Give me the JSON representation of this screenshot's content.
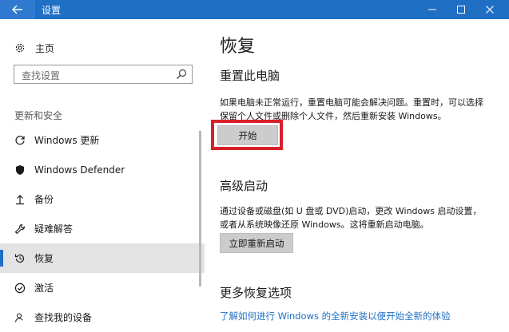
{
  "window": {
    "title": "设置",
    "colors": {
      "titlebar": "#1f6fc5",
      "accent": "#1f6fc5",
      "highlight": "#d8202a"
    }
  },
  "sidebar": {
    "home_label": "主页",
    "search_placeholder": "查找设置",
    "section_label": "更新和安全",
    "items": [
      {
        "label": "Windows 更新",
        "icon": "refresh-icon",
        "active": false
      },
      {
        "label": "Windows Defender",
        "icon": "shield-icon",
        "active": false
      },
      {
        "label": "备份",
        "icon": "backup-arrow-icon",
        "active": false
      },
      {
        "label": "疑难解答",
        "icon": "wrench-icon",
        "active": false
      },
      {
        "label": "恢复",
        "icon": "history-icon",
        "active": true
      },
      {
        "label": "激活",
        "icon": "check-circle-icon",
        "active": false
      },
      {
        "label": "查找我的设备",
        "icon": "person-location-icon",
        "active": false
      }
    ]
  },
  "main": {
    "page_title": "恢复",
    "reset": {
      "title": "重置此电脑",
      "description": "如果电脑未正常运行，重置电脑可能会解决问题。重置时，可以选择保留个人文件或删除个人文件，然后重新安装 Windows。",
      "button_label": "开始"
    },
    "advanced": {
      "title": "高级启动",
      "description": "通过设备或磁盘(如 U 盘或 DVD)启动，更改 Windows 启动设置，或者从系统映像还原 Windows。这将重新启动电脑。",
      "button_label": "立即重新启动"
    },
    "more": {
      "title": "更多恢复选项",
      "link": "了解如何进行 Windows 的全新安装以便开始全新的体验"
    }
  }
}
